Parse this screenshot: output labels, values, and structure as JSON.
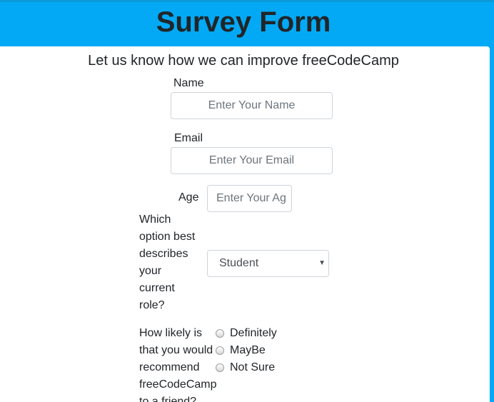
{
  "header": {
    "title": "Survey Form"
  },
  "form": {
    "description": "Let us know how we can improve freeCodeCamp",
    "name": {
      "label": "Name",
      "placeholder": "Enter Your Name"
    },
    "email": {
      "label": "Email",
      "placeholder": "Enter Your Email"
    },
    "age": {
      "label": "Age",
      "placeholder": "Enter Your Age"
    },
    "role": {
      "label_lines": [
        "Which",
        "option best",
        "describes",
        "your",
        "current",
        "role?"
      ],
      "selected": "Student"
    },
    "recommend": {
      "label_lines": [
        "How likely is",
        "that you would",
        "recommend",
        "freeCodeCamp",
        "to a friend?"
      ],
      "options": [
        "Definitely",
        "MayBe",
        "Not Sure"
      ]
    }
  },
  "colors": {
    "header_background": "#03a9f4",
    "card_background": "#ffffff",
    "text": "#212529"
  }
}
